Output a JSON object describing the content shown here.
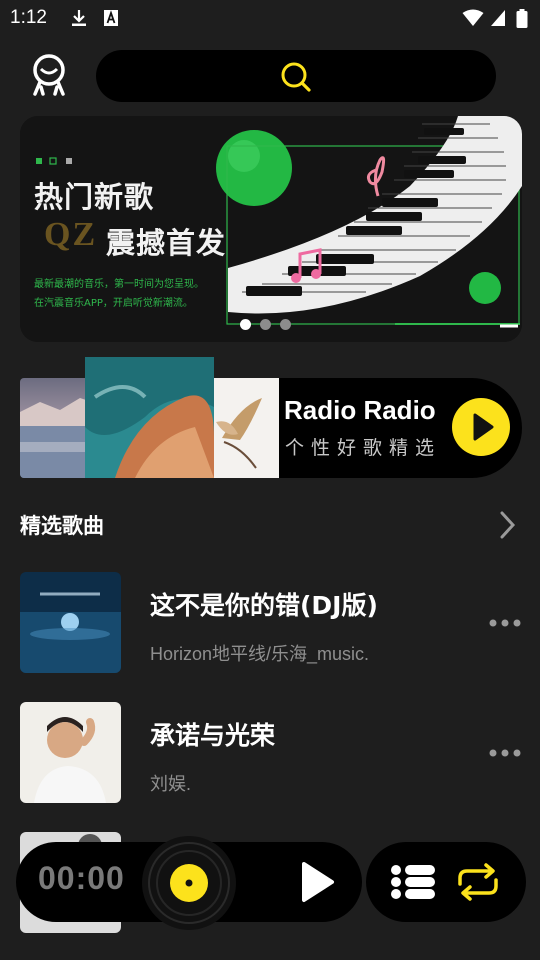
{
  "status": {
    "time": "1:12"
  },
  "banner": {
    "heading_1": "热门新歌",
    "heading_2": "震撼首发",
    "logo": "QZ",
    "desc_line_1": "最新最潮的音乐，第一时间为您呈现。",
    "desc_line_2": "在汽震音乐APP，开启听觉新潮流。",
    "slides": 3,
    "active_slide": 1
  },
  "radio": {
    "title": "Radio Radio",
    "subtitle": "个性好歌精选"
  },
  "section": {
    "title": "精选歌曲"
  },
  "songs": [
    {
      "title": "这不是你的错(DJ版)",
      "artist": "Horizon地平线/乐海_music."
    },
    {
      "title": "承诺与光荣",
      "artist": "刘娱."
    }
  ],
  "player": {
    "time": "00:00"
  },
  "colors": {
    "accent": "#fce21c",
    "background": "#1e1e1e",
    "surface": "#000000",
    "banner_green": "#2fb84c"
  }
}
